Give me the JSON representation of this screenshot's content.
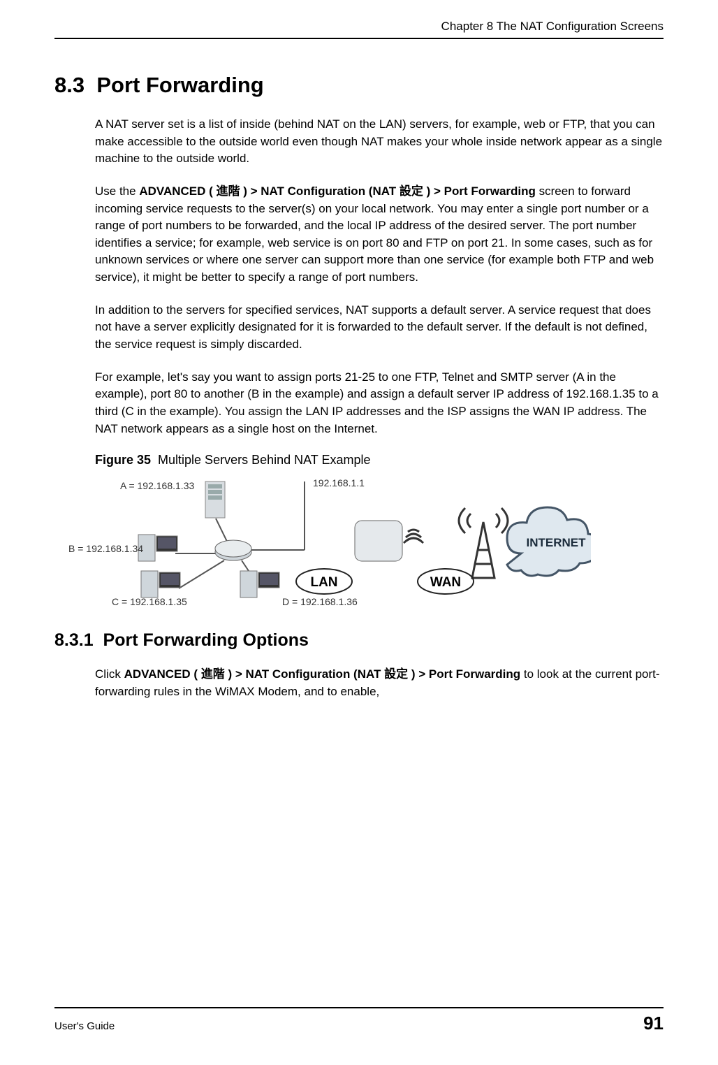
{
  "header": {
    "chapter_line": "Chapter 8 The NAT Configuration Screens"
  },
  "sections": {
    "num_h2": "8.3",
    "title_h2": "Port Forwarding",
    "p1": "A NAT server set is a list of inside (behind NAT on the LAN) servers, for example, web or FTP, that you can make accessible to the outside world even though NAT makes your whole inside network appear as a single machine to the outside world.",
    "p2a": "Use the ",
    "p2_bold": "ADVANCED ( 進階 ) > NAT Configuration (NAT 設定 ) > Port Forwarding",
    "p2b": " screen to forward incoming service requests to the server(s) on your local network. You may enter a single port number or a range of port numbers to be forwarded, and the local IP address of the desired server. The port number identifies a service; for example, web service is on port 80 and FTP on port 21. In some cases, such as for unknown services or where one server can support more than one service (for example both FTP and web service), it might be better to specify a range of port numbers.",
    "p3": "In addition to the servers for specified services, NAT supports a default server. A service request that does not have a server explicitly designated for it is forwarded to the default server. If the default is not defined, the service request is simply discarded.",
    "p4": "For example, let's say you want to assign ports 21-25 to one FTP, Telnet and SMTP server (A in the example), port 80 to another (B in the example) and assign a default server IP address of 192.168.1.35 to a third (C in the example). You assign the LAN IP addresses and the ISP assigns the WAN IP address. The NAT network appears as a single host on the Internet.",
    "figure": {
      "num": "Figure 35",
      "caption": "Multiple Servers Behind NAT Example",
      "label_a": "A = 192.168.1.33",
      "label_b": "B = 192.168.1.34",
      "label_c": "C = 192.168.1.35",
      "label_d": "D = 192.168.1.36",
      "label_router": "192.168.1.1",
      "label_lan": "LAN",
      "label_wan": "WAN",
      "label_internet": "INTERNET"
    },
    "num_h3": "8.3.1",
    "title_h3": "Port Forwarding Options",
    "p5a": "Click ",
    "p5_bold": "ADVANCED ( 進階 ) > NAT Configuration (NAT 設定 ) > Port Forwarding",
    "p5b": " to look at the current port-forwarding rules in the WiMAX Modem, and to enable,"
  },
  "footer": {
    "guide": "User's Guide",
    "page": "91"
  }
}
